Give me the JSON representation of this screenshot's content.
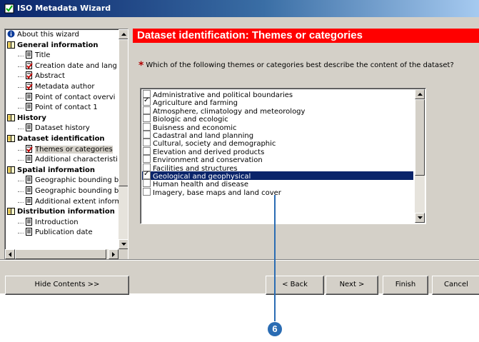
{
  "window": {
    "title": "ISO Metadata Wizard"
  },
  "toc": {
    "items": [
      {
        "label": "About this wizard",
        "icon": "info-icon",
        "level": 0,
        "bold": false
      },
      {
        "label": "General information",
        "icon": "book-icon",
        "level": 0,
        "bold": true
      },
      {
        "label": "Title",
        "icon": "page-icon",
        "level": 1,
        "bold": false
      },
      {
        "label": "Creation date and lang",
        "icon": "page-check-icon",
        "level": 1,
        "bold": false
      },
      {
        "label": "Abstract",
        "icon": "page-check-icon",
        "level": 1,
        "bold": false
      },
      {
        "label": "Metadata author",
        "icon": "page-check-icon",
        "level": 1,
        "bold": false
      },
      {
        "label": "Point of contact overvi",
        "icon": "page-icon",
        "level": 1,
        "bold": false
      },
      {
        "label": "Point of contact 1",
        "icon": "page-icon",
        "level": 1,
        "bold": false
      },
      {
        "label": "History",
        "icon": "book-icon",
        "level": 0,
        "bold": true
      },
      {
        "label": "Dataset history",
        "icon": "page-icon",
        "level": 1,
        "bold": false
      },
      {
        "label": "Dataset identification",
        "icon": "book-icon",
        "level": 0,
        "bold": true
      },
      {
        "label": "Themes or categories",
        "icon": "page-check-icon",
        "level": 1,
        "bold": false,
        "selected": true
      },
      {
        "label": "Additional characteristi",
        "icon": "page-icon",
        "level": 1,
        "bold": false
      },
      {
        "label": "Spatial information",
        "icon": "book-icon",
        "level": 0,
        "bold": true
      },
      {
        "label": "Geographic bounding b",
        "icon": "page-icon",
        "level": 1,
        "bold": false
      },
      {
        "label": "Geographic bounding b",
        "icon": "page-icon",
        "level": 1,
        "bold": false
      },
      {
        "label": "Additional extent inform",
        "icon": "page-icon",
        "level": 1,
        "bold": false
      },
      {
        "label": "Distribution information",
        "icon": "book-icon",
        "level": 0,
        "bold": true
      },
      {
        "label": "Introduction",
        "icon": "page-icon",
        "level": 1,
        "bold": false
      },
      {
        "label": "Publication date",
        "icon": "page-icon",
        "level": 1,
        "bold": false
      }
    ]
  },
  "page": {
    "header": "Dataset identification: Themes or categories",
    "required_mark": "*",
    "question": "Which of the following themes or categories best describe the content of the dataset?"
  },
  "themes": [
    {
      "label": "Administrative and political boundaries",
      "checked": false
    },
    {
      "label": "Agriculture and farming",
      "checked": true
    },
    {
      "label": "Atmosphere, climatology and meteorology",
      "checked": false
    },
    {
      "label": "Biologic and ecologic",
      "checked": false
    },
    {
      "label": "Buisness and economic",
      "checked": false
    },
    {
      "label": "Cadastral and land planning",
      "checked": false
    },
    {
      "label": "Cultural, society and demographic",
      "checked": false
    },
    {
      "label": "Elevation and derived products",
      "checked": false
    },
    {
      "label": "Environment and conservation",
      "checked": false
    },
    {
      "label": "Facilities and structures",
      "checked": false
    },
    {
      "label": "Geological and geophysical",
      "checked": true,
      "selected": true
    },
    {
      "label": "Human health and disease",
      "checked": false
    },
    {
      "label": "Imagery, base maps and land cover",
      "checked": false
    }
  ],
  "buttons": {
    "hide_contents": "Hide Contents >>",
    "back": "< Back",
    "next": "Next >",
    "finish": "Finish",
    "cancel": "Cancel"
  },
  "callout": {
    "number": "6"
  },
  "colors": {
    "header_bg": "#ff0000",
    "selection": "#0a246a",
    "callout": "#2a6cb3"
  }
}
